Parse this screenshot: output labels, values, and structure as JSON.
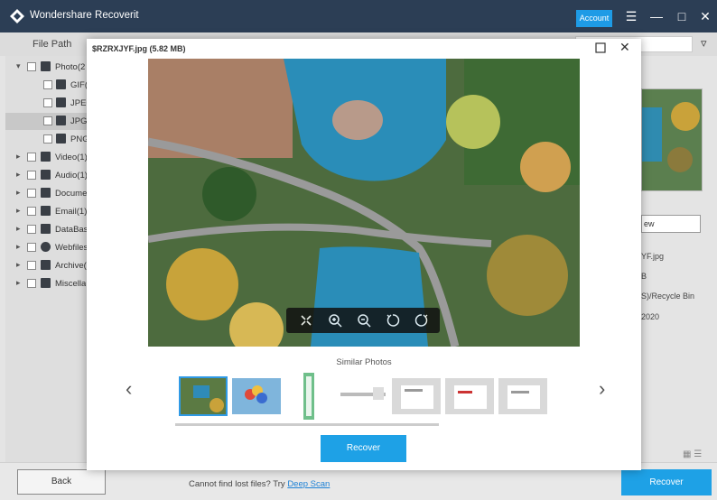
{
  "app": {
    "title": "Wondershare Recoverit",
    "account_label": "Account"
  },
  "toolbar": {
    "file_path_label": "File Path"
  },
  "tree": [
    {
      "label": "Photo(2",
      "expanded": true,
      "icon": "image-icon"
    },
    {
      "label": "GIF(",
      "icon": "folder-icon"
    },
    {
      "label": "JPEG",
      "icon": "folder-icon"
    },
    {
      "label": "JPG(",
      "icon": "folder-icon",
      "selected": true
    },
    {
      "label": "PNG",
      "icon": "folder-icon"
    },
    {
      "label": "Video(1)",
      "icon": "video-icon"
    },
    {
      "label": "Audio(1)",
      "icon": "music-icon"
    },
    {
      "label": "Docume",
      "icon": "document-icon"
    },
    {
      "label": "Email(1)",
      "icon": "email-icon"
    },
    {
      "label": "DataBas",
      "icon": "database-icon"
    },
    {
      "label": "Webfiles",
      "icon": "globe-icon"
    },
    {
      "label": "Archive(",
      "icon": "archive-icon"
    },
    {
      "label": "Miscella",
      "icon": "misc-icon"
    }
  ],
  "details": {
    "preview_button": "ew",
    "name": "YF.jpg",
    "size": "B",
    "path": "S)/Recycle Bin",
    "date": "2020"
  },
  "modal": {
    "title": "$RZRXJYF.jpg (5.82 MB)",
    "similar_label": "Similar Photos",
    "recover_label": "Recover",
    "zoom_tools": [
      "fit-screen-icon",
      "zoom-in-icon",
      "zoom-out-icon",
      "rotate-left-icon",
      "rotate-right-icon"
    ]
  },
  "bottom": {
    "back_label": "Back",
    "hint_text": "Cannot find lost files? Try ",
    "deep_scan_label": "Deep Scan",
    "recover_label": "Recover"
  },
  "colors": {
    "titlebar": "#2c3e55",
    "accent": "#1ea1e6"
  }
}
